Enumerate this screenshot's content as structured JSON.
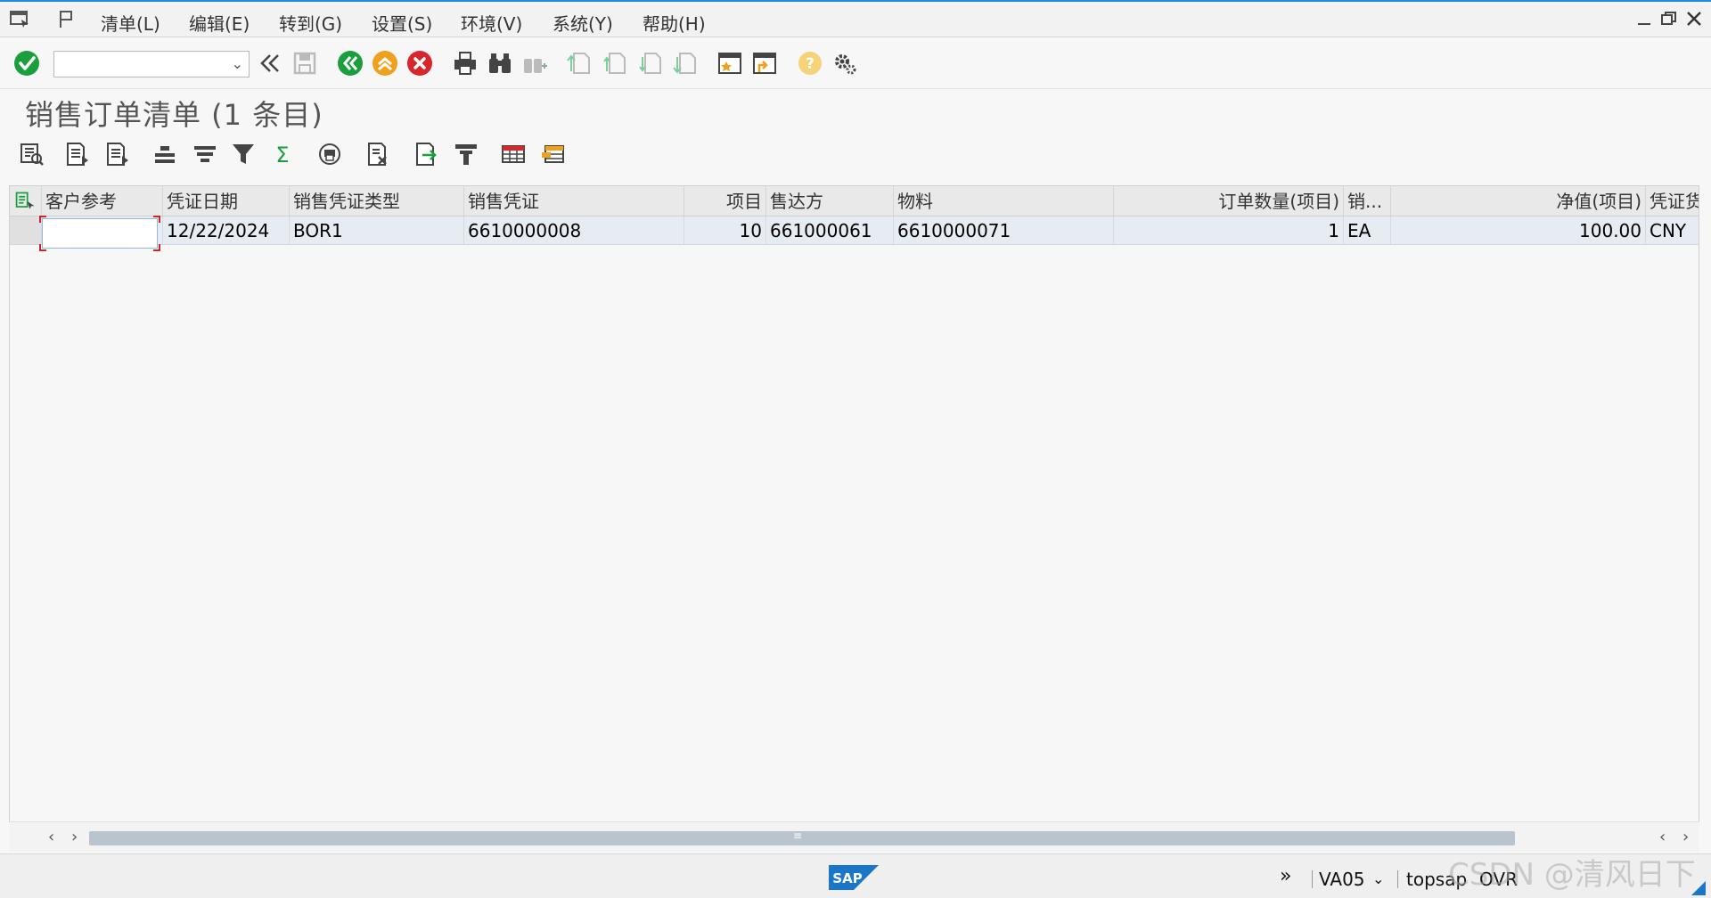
{
  "menu": {
    "items": [
      "清单(L)",
      "编辑(E)",
      "转到(G)",
      "设置(S)",
      "环境(V)",
      "系统(Y)",
      "帮助(H)"
    ]
  },
  "toolbar": {
    "command_value": "",
    "icons": [
      "enter-icon",
      "back-double-icon",
      "save-icon",
      "back-icon",
      "exit-icon",
      "cancel-icon",
      "print-icon",
      "find-icon",
      "find-next-icon",
      "first-page-icon",
      "prev-page-icon",
      "next-page-icon",
      "last-page-icon",
      "create-session-icon",
      "shortcut-icon",
      "help-icon",
      "settings-icon"
    ]
  },
  "title": "销售订单清单 (1 条目)",
  "grid": {
    "columns": [
      "客户参考",
      "凭证日期",
      "销售凭证类型",
      "销售凭证",
      "项目",
      "售达方",
      "物料",
      "订单数量(项目)",
      "销...",
      "净值(项目)",
      "凭证货"
    ],
    "rows": [
      {
        "customer_ref": "",
        "doc_date": "12/22/2024",
        "doc_type": "BOR1",
        "sales_doc": "6610000008",
        "item": "10",
        "sold_to": "661000061",
        "material": "6610000071",
        "order_qty": "1",
        "unit": "EA",
        "net_value": "100.00",
        "currency": "CNY"
      }
    ]
  },
  "statusbar": {
    "brand": "SAP",
    "transaction": "VA05",
    "system": "topsap",
    "mode": "OVR"
  },
  "watermark": "CSDN @清风日下",
  "colors": {
    "accent": "#1e88e5",
    "enter_green": "#1b9e3e",
    "exit_orange": "#f0a01c",
    "cancel_red": "#d9262c",
    "sap_blue": "#1a76c9"
  }
}
